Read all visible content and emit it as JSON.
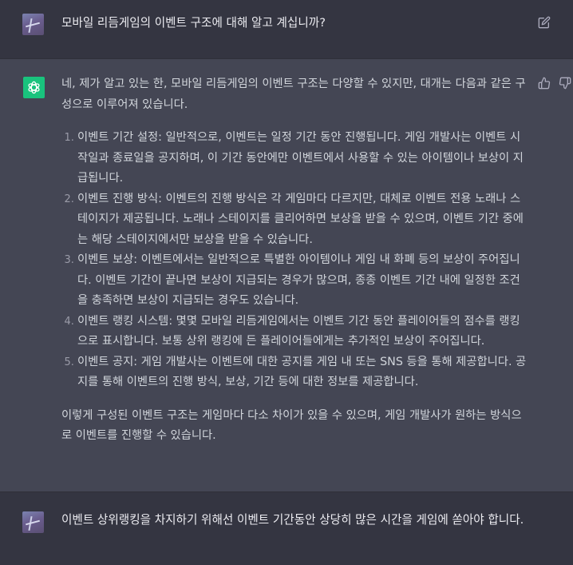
{
  "conversation": {
    "user_message_1": "모바일 리듬게임의 이벤트 구조에 대해 알고 계십니까?",
    "assistant_intro": "네, 제가 알고 있는 한, 모바일 리듬게임의 이벤트 구조는 다양할 수 있지만, 대개는 다음과 같은 구성으로 이루어져 있습니다.",
    "assistant_items": [
      "이벤트 기간 설정: 일반적으로, 이벤트는 일정 기간 동안 진행됩니다. 게임 개발사는 이벤트 시작일과 종료일을 공지하며, 이 기간 동안에만 이벤트에서 사용할 수 있는 아이템이나 보상이 지급됩니다.",
      "이벤트 진행 방식: 이벤트의 진행 방식은 각 게임마다 다르지만, 대체로 이벤트 전용 노래나 스테이지가 제공됩니다. 노래나 스테이지를 클리어하면 보상을 받을 수 있으며, 이벤트 기간 중에는 해당 스테이지에서만 보상을 받을 수 있습니다.",
      "이벤트 보상: 이벤트에서는 일반적으로 특별한 아이템이나 게임 내 화폐 등의 보상이 주어집니다. 이벤트 기간이 끝나면 보상이 지급되는 경우가 많으며, 종종 이벤트 기간 내에 일정한 조건을 충족하면 보상이 지급되는 경우도 있습니다.",
      "이벤트 랭킹 시스템: 몇몇 모바일 리듬게임에서는 이벤트 기간 동안 플레이어들의 점수를 랭킹으로 표시합니다. 보통 상위 랭킹에 든 플레이어들에게는 추가적인 보상이 주어집니다.",
      "이벤트 공지: 게임 개발사는 이벤트에 대한 공지를 게임 내 또는 SNS 등을 통해 제공합니다. 공지를 통해 이벤트의 진행 방식, 보상, 기간 등에 대한 정보를 제공합니다."
    ],
    "assistant_outro": "이렇게 구성된 이벤트 구조는 게임마다 다소 차이가 있을 수 있으며, 게임 개발사가 원하는 방식으로 이벤트를 진행할 수 있습니다.",
    "user_message_2": "이벤트 상위랭킹을 차지하기 위해선 이벤트 기간동안 상당히 많은 시간을 게임에 쏟아야 합니다."
  },
  "icons": {
    "edit": "edit-icon",
    "thumbs_up": "thumbs-up-icon",
    "thumbs_down": "thumbs-down-icon",
    "assistant_logo": "openai-logo-icon"
  },
  "colors": {
    "background": "#343541",
    "assistant_background": "#444654",
    "assistant_avatar": "#19c37d",
    "text": "#ececf1",
    "assistant_text": "#d1d5db"
  }
}
